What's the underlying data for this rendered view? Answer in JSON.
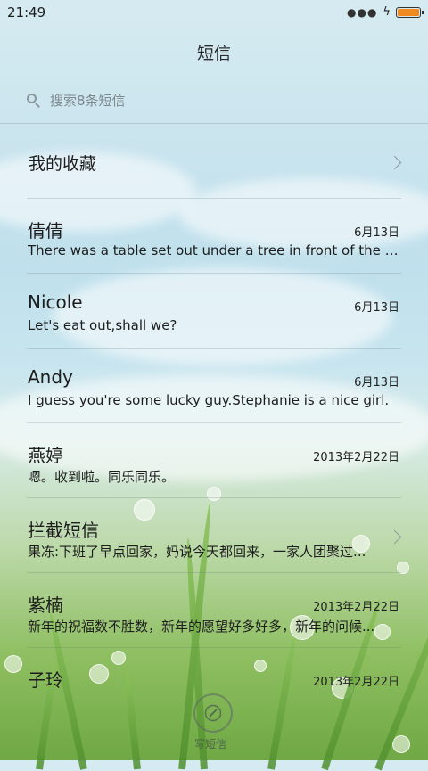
{
  "status": {
    "time": "21:49",
    "battery_level": 1.0,
    "battery_color": "#f08a1e"
  },
  "header": {
    "title": "短信"
  },
  "search": {
    "placeholder": "搜索8条短信"
  },
  "favorites": {
    "label": "我的收藏"
  },
  "messages": [
    {
      "name": "倩倩",
      "date": "6月13日",
      "preview": "There was a table set out under a tree in front of the ho..."
    },
    {
      "name": "Nicole",
      "date": "6月13日",
      "preview": "Let's eat out,shall we?"
    },
    {
      "name": "Andy",
      "date": "6月13日",
      "preview": "I guess you're some lucky guy.Stephanie is a nice girl."
    },
    {
      "name": "燕婷",
      "date": "2013年2月22日",
      "preview": "嗯。收到啦。同乐同乐。"
    },
    {
      "name": "拦截短信",
      "date": "",
      "preview": "果冻:下班了早点回家，妈说今天都回来，一家人团聚过..."
    },
    {
      "name": "紫楠",
      "date": "2013年2月22日",
      "preview": "新年的祝福数不胜数，新年的愿望好多好多，新年的问候..."
    },
    {
      "name": "子玲",
      "date": "2013年2月22日",
      "preview": ""
    }
  ],
  "compose": {
    "label": "写短信",
    "icon": "compose-icon"
  }
}
